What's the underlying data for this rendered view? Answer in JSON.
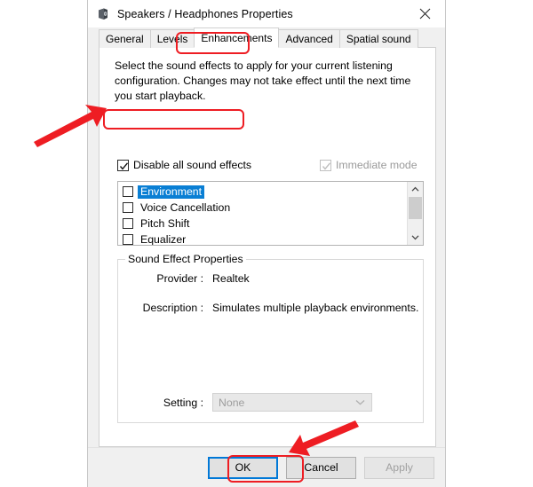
{
  "window": {
    "title": "Speakers / Headphones Properties",
    "icon": "speaker-device-icon",
    "close_label": "✕"
  },
  "tabs": [
    {
      "label": "General",
      "active": false
    },
    {
      "label": "Levels",
      "active": false
    },
    {
      "label": "Enhancements",
      "active": true
    },
    {
      "label": "Advanced",
      "active": false
    },
    {
      "label": "Spatial sound",
      "active": false
    }
  ],
  "panel": {
    "intro": "Select the sound effects to apply for your current listening configuration. Changes may not take effect until the next time you start playback.",
    "disable_all": {
      "label": "Disable all sound effects",
      "checked": true,
      "enabled": true
    },
    "immediate_mode": {
      "label": "Immediate mode",
      "checked": true,
      "enabled": false
    },
    "effects_list": [
      {
        "label": "Environment",
        "checked": false,
        "selected": true
      },
      {
        "label": "Voice Cancellation",
        "checked": false,
        "selected": false
      },
      {
        "label": "Pitch Shift",
        "checked": false,
        "selected": false
      },
      {
        "label": "Equalizer",
        "checked": false,
        "selected": false
      }
    ],
    "scrollbar": {
      "up": "∧",
      "down": "∨"
    }
  },
  "group": {
    "legend": "Sound Effect Properties",
    "provider_label": "Provider :",
    "provider_value": "Realtek",
    "description_label": "Description :",
    "description_value": "Simulates multiple playback environments.",
    "setting_label": "Setting :",
    "setting_value": "None",
    "setting_enabled": false
  },
  "buttons": {
    "ok": "OK",
    "cancel": "Cancel",
    "apply": "Apply",
    "apply_enabled": false
  },
  "annotations": {
    "highlight_color": "#ee1d23",
    "arrow_color": "#ee1d23",
    "selection_color": "#0a7fd4",
    "focus_color": "#0078d7",
    "boxes": [
      "enhancements-tab",
      "disable-all-sound-effects-checkbox",
      "ok-button"
    ],
    "arrows": [
      "arrow-to-disable-checkbox",
      "arrow-to-ok-button"
    ]
  }
}
